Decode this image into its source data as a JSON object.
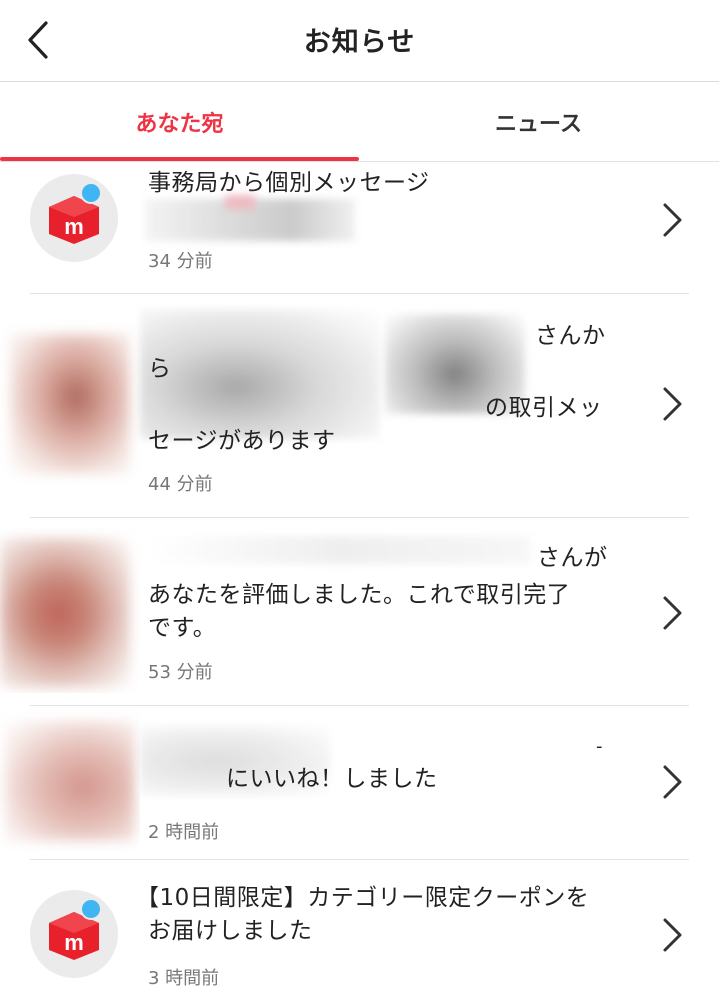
{
  "header": {
    "title": "お知らせ",
    "back_icon": "chevron-left-icon"
  },
  "tabs": [
    {
      "label": "あなた宛",
      "active": true
    },
    {
      "label": "ニュース",
      "active": false
    }
  ],
  "colors": {
    "accent": "#ee3344",
    "badge": "#3fb5f4",
    "logo_red": "#e8202b"
  },
  "notifications": [
    {
      "lines": [
        "事務局から個別メッセージ"
      ],
      "time": "34 分前",
      "avatar": "mercari-logo"
    },
    {
      "lines": [
        "さんか",
        "ら",
        "の取引メッ",
        "セージがあります"
      ],
      "time": "44 分前",
      "avatar": "user-photo"
    },
    {
      "lines": [
        "さんが",
        "あなたを評価しました。これで取引完了",
        "です。"
      ],
      "time": "53 分前",
      "avatar": "user-photo"
    },
    {
      "lines": [
        "-",
        "にいいね！しました"
      ],
      "time": "2 時間前",
      "avatar": "user-photo"
    },
    {
      "lines": [
        "【10日間限定】カテゴリー限定クーポンを",
        "お届けしました"
      ],
      "time": "3 時間前",
      "avatar": "mercari-logo"
    }
  ]
}
